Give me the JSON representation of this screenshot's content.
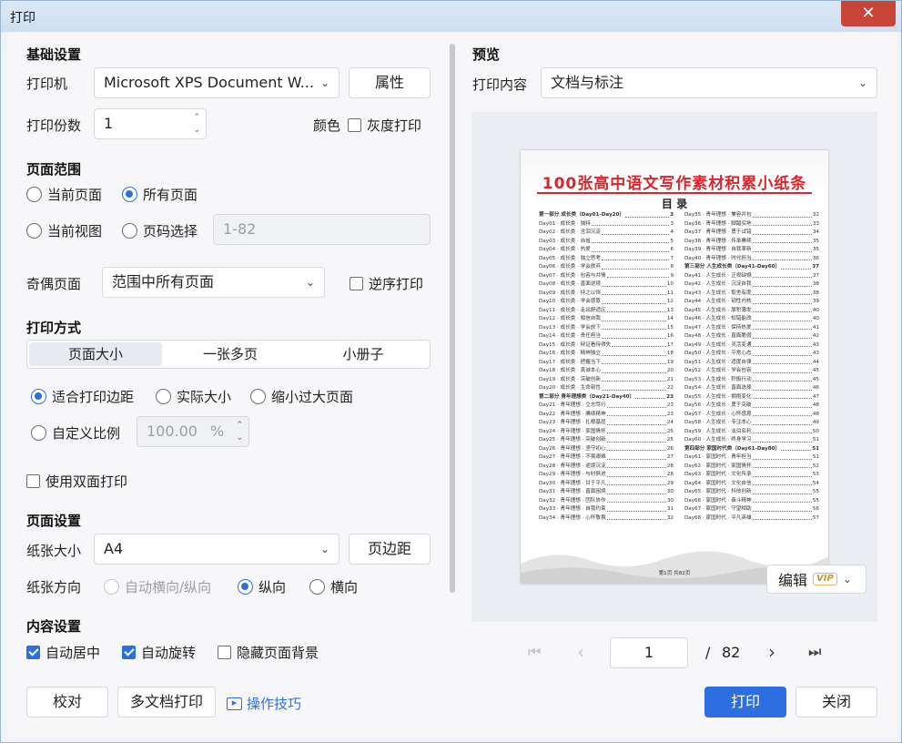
{
  "window": {
    "title": "打印",
    "close_glyph": "✕"
  },
  "basic": {
    "title": "基础设置",
    "printer_label": "打印机",
    "printer_value": "Microsoft XPS Document W...",
    "properties_button": "属性",
    "copies_label": "打印份数",
    "copies_value": "1",
    "color_label": "颜色",
    "grayscale_label": "灰度打印",
    "grayscale_checked": false
  },
  "page_range": {
    "title": "页面范围",
    "options": [
      "当前页面",
      "所有页面",
      "当前视图",
      "页码选择"
    ],
    "selected": "所有页面",
    "page_input_placeholder": "1-82",
    "odd_even_label": "奇偶页面",
    "odd_even_value": "范围中所有页面",
    "reverse_label": "逆序打印",
    "reverse_checked": false
  },
  "print_mode": {
    "title": "打印方式",
    "tabs": [
      "页面大小",
      "一张多页",
      "小册子"
    ],
    "active_tab": "页面大小",
    "options": [
      "适合打印边距",
      "实际大小",
      "缩小过大页面",
      "自定义比例"
    ],
    "selected": "适合打印边距",
    "scale_value": "100.00",
    "scale_unit": "%",
    "duplex_label": "使用双面打印",
    "duplex_checked": false
  },
  "page_setup": {
    "title": "页面设置",
    "paper_label": "纸张大小",
    "paper_value": "A4",
    "margins_button": "页边距",
    "orientation_label": "纸张方向",
    "orientation_options": [
      "自动横向/纵向",
      "纵向",
      "横向"
    ],
    "orientation_selected": "纵向"
  },
  "content": {
    "title": "内容设置",
    "auto_center": "自动居中",
    "auto_rotate": "自动旋转",
    "hide_background": "隐藏页面背景",
    "auto_center_checked": true,
    "auto_rotate_checked": true,
    "hide_background_checked": false
  },
  "footer": {
    "proof_button": "校对",
    "multi_doc_button": "多文档打印",
    "tips_link": "操作技巧",
    "print_button": "打印",
    "close_button": "关闭"
  },
  "preview": {
    "title": "预览",
    "content_label": "打印内容",
    "content_value": "文档与标注",
    "edit_button": "编辑",
    "vip_badge": "VIP",
    "current_page": "1",
    "page_separator": "/",
    "total_pages": "82",
    "doc": {
      "title": "100张高中语文写作素材积累小纸条",
      "toc_title": "目 录",
      "footer": "第1页 共82页",
      "left_column": [
        {
          "t": "第一部分 成长类（Day01-Day20）",
          "n": "3",
          "sec": true
        },
        {
          "t": "Day01 · 成长类 · 独特",
          "n": "3"
        },
        {
          "t": "Day02 · 成长类 · 含泪沉淀",
          "n": "4"
        },
        {
          "t": "Day03 · 成长类 · 自省",
          "n": "5"
        },
        {
          "t": "Day04 · 成长类 · 热爱",
          "n": "6"
        },
        {
          "t": "Day05 · 成长类 · 独立思考",
          "n": "7"
        },
        {
          "t": "Day06 · 成长类 · 学会放弃",
          "n": "8"
        },
        {
          "t": "Day07 · 成长类 · 包容与共情",
          "n": "9"
        },
        {
          "t": "Day08 · 成长类 · 直面逆境",
          "n": "10"
        },
        {
          "t": "Day09 · 成长类 · 持之以恒",
          "n": "11"
        },
        {
          "t": "Day10 · 成长类 · 学会感恩",
          "n": "12"
        },
        {
          "t": "Day11 · 成长类 · 走出舒适区",
          "n": "13"
        },
        {
          "t": "Day12 · 成长类 · 相信自我",
          "n": "14"
        },
        {
          "t": "Day13 · 成长类 · 学会放下",
          "n": "15"
        },
        {
          "t": "Day14 · 成长类 · 责任担当",
          "n": "16"
        },
        {
          "t": "Day15 · 成长类 · 辩证看待得失",
          "n": "17"
        },
        {
          "t": "Day16 · 成长类 · 精神独立",
          "n": "18"
        },
        {
          "t": "Day17 · 成长类 · 把握当下",
          "n": "19"
        },
        {
          "t": "Day18 · 成长类 · 真诚本心",
          "n": "20"
        },
        {
          "t": "Day19 · 成长类 · 突破创新",
          "n": "21"
        },
        {
          "t": "Day20 · 成长类 · 生命韧性",
          "n": "22"
        },
        {
          "t": "第二部分 青年理想类（Day21-Day40）",
          "n": "23",
          "sec": true
        },
        {
          "t": "Day21 · 青年理想 · 立志笃行",
          "n": "23"
        },
        {
          "t": "Day22 · 青年理想 · 赓续精神",
          "n": "23"
        },
        {
          "t": "Day23 · 青年理想 · 扎根基层",
          "n": "24"
        },
        {
          "t": "Day24 · 青年理想 · 家国情怀",
          "n": "25"
        },
        {
          "t": "Day25 · 青年理想 · 突破创新",
          "n": "25"
        },
        {
          "t": "Day26 · 青年理想 · 坚守初心",
          "n": "26"
        },
        {
          "t": "Day27 · 青年理想 · 不畏艰难",
          "n": "27"
        },
        {
          "t": "Day28 · 青年理想 · 逆境沉淀",
          "n": "28"
        },
        {
          "t": "Day29 · 青年理想 · 与时俱进",
          "n": "28"
        },
        {
          "t": "Day30 · 青年理想 · 甘于平凡",
          "n": "29"
        },
        {
          "t": "Day31 · 青年理想 · 直面困境",
          "n": "30"
        },
        {
          "t": "Day32 · 青年理想 · 团队协作",
          "n": "30"
        },
        {
          "t": "Day33 · 青年理想 · 自我约束",
          "n": "31"
        },
        {
          "t": "Day34 · 青年理想 · 心怀敬畏",
          "n": "32"
        }
      ],
      "right_column": [
        {
          "t": "Day35 · 青年理想 · 兼容并包",
          "n": "32"
        },
        {
          "t": "Day36 · 青年理想 · 脚踏实地",
          "n": "33"
        },
        {
          "t": "Day37 · 青年理想 · 勇于试错",
          "n": "34"
        },
        {
          "t": "Day38 · 青年理想 · 传承赓续",
          "n": "35"
        },
        {
          "t": "Day39 · 青年理想 · 自我革新",
          "n": "35"
        },
        {
          "t": "Day40 · 青年理想 · 时代担当",
          "n": "36"
        },
        {
          "t": "第三部分 人生成长类（Day41-Day60）",
          "n": "37",
          "sec": true
        },
        {
          "t": "Day41 · 人生成长 · 正视缺憾",
          "n": "37"
        },
        {
          "t": "Day42 · 人生成长 · 沉淀自我",
          "n": "38"
        },
        {
          "t": "Day43 · 人生成长 · 取舍有度",
          "n": "38"
        },
        {
          "t": "Day44 · 人生成长 · 韧性内核",
          "n": "39"
        },
        {
          "t": "Day45 · 人生成长 · 厚积薄发",
          "n": "40"
        },
        {
          "t": "Day46 · 人生成长 · 知错能改",
          "n": "40"
        },
        {
          "t": "Day47 · 人生成长 · 保持热爱",
          "n": "41"
        },
        {
          "t": "Day48 · 人生成长 · 直面脆弱",
          "n": "42"
        },
        {
          "t": "Day49 · 人生成长 · 灵活变通",
          "n": "43"
        },
        {
          "t": "Day50 · 人生成长 · 平常心态",
          "n": "43"
        },
        {
          "t": "Day51 · 人生成长 · 适度自律",
          "n": "44"
        },
        {
          "t": "Day52 · 人生成长 · 学会包容",
          "n": "45"
        },
        {
          "t": "Day53 · 人生成长 · 积极行动",
          "n": "45"
        },
        {
          "t": "Day54 · 人生成长 · 直面选择",
          "n": "46"
        },
        {
          "t": "Day55 · 人生成长 · 拥抱变化",
          "n": "47"
        },
        {
          "t": "Day56 · 人生成长 · 勇于突破",
          "n": "48"
        },
        {
          "t": "Day57 · 人生成长 · 心怀感恩",
          "n": "48"
        },
        {
          "t": "Day58 · 人生成长 · 专注本心",
          "n": "49"
        },
        {
          "t": "Day59 · 人生成长 · 淡泊名利",
          "n": "50"
        },
        {
          "t": "Day60 · 人生成长 · 终身学习",
          "n": "51"
        },
        {
          "t": "第四部分 家国时代类（Day61-Day80）",
          "n": "51",
          "sec": true
        },
        {
          "t": "Day61 · 家国时代 · 青年担当",
          "n": "51"
        },
        {
          "t": "Day62 · 家国时代 · 家国情怀",
          "n": "52"
        },
        {
          "t": "Day63 · 家国时代 · 文化传承",
          "n": "53"
        },
        {
          "t": "Day64 · 家国时代 · 文化自信",
          "n": "54"
        },
        {
          "t": "Day65 · 家国时代 · 科技创新",
          "n": "55"
        },
        {
          "t": "Day66 · 家国时代 · 奋斗精神",
          "n": "55"
        },
        {
          "t": "Day67 · 家国时代 · 守望相助",
          "n": "56"
        },
        {
          "t": "Day68 · 家国时代 · 平凡英雄",
          "n": "57"
        }
      ]
    }
  },
  "colors": {
    "accent": "#2d6fe0",
    "doc_title": "#d8262e",
    "close": "#c9453a"
  },
  "icons": {
    "chevron_down": "⌄",
    "spin_up": "⌃",
    "spin_down": "⌄",
    "first_page": "⏮",
    "prev_page": "‹",
    "next_page": "›",
    "last_page": "⏭",
    "tips_icon": "▶"
  }
}
